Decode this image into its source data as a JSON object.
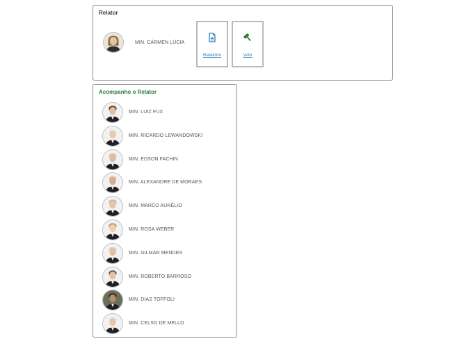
{
  "relator": {
    "title": "Relator",
    "minister": {
      "name": "MIN. CÁRMEN LÚCIA"
    },
    "actions": {
      "relatorio_label": "Relatório",
      "voto_label": "Voto"
    }
  },
  "acompanho": {
    "title": "Acompanho o Relator",
    "ministers": [
      {
        "name": "MIN. LUIZ FUX"
      },
      {
        "name": "MIN. RICARDO LEWANDOWSKI"
      },
      {
        "name": "MIN. EDSON FACHIN"
      },
      {
        "name": "MIN. ALEXANDRE DE MORAES"
      },
      {
        "name": "MIN. MARCO AURÉLIO"
      },
      {
        "name": "MIN. ROSA WEBER"
      },
      {
        "name": "MIN. GILMAR MENDES"
      },
      {
        "name": "MIN. ROBERTO BARROSO"
      },
      {
        "name": "MIN. DIAS TOFFOLI"
      },
      {
        "name": "MIN. CELSO DE MELLO"
      }
    ]
  },
  "colors": {
    "accent_green": "#2e7d32",
    "link_blue": "#2a7fb8",
    "border": "#8a8a8a"
  },
  "icons": {
    "relatorio": "document-icon",
    "voto": "gavel-icon"
  }
}
